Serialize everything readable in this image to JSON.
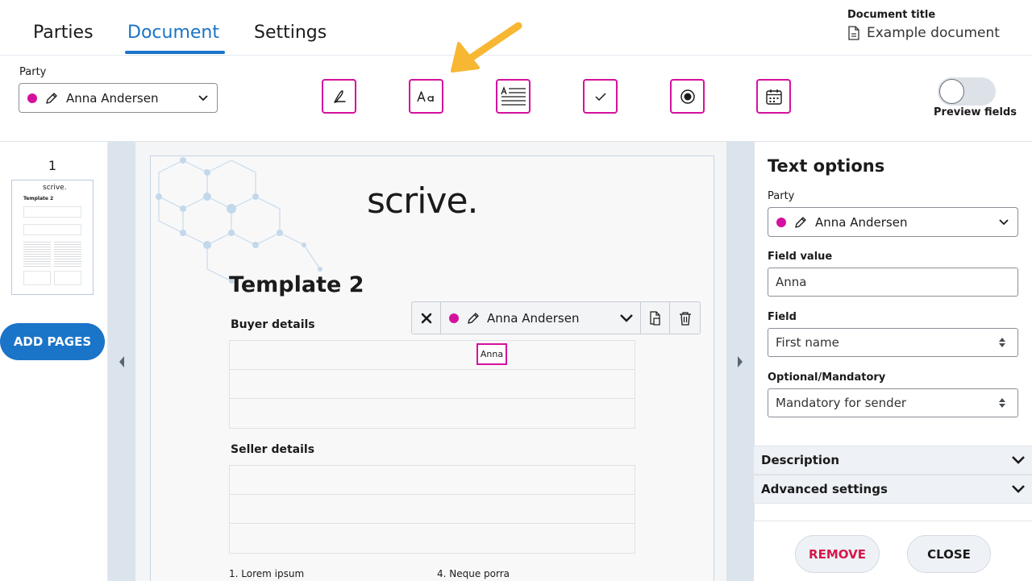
{
  "header": {
    "tabs": [
      {
        "label": "Parties"
      },
      {
        "label": "Document"
      },
      {
        "label": "Settings"
      }
    ],
    "document_title_label": "Document title",
    "document_title_value": "Example document"
  },
  "toolbar": {
    "party_label": "Party",
    "party_value": "Anna Andersen",
    "party_color": "#d4119e",
    "field_tools": [
      {
        "icon": "signature-icon"
      },
      {
        "icon": "text-field-icon"
      },
      {
        "icon": "textarea-icon"
      },
      {
        "icon": "checkbox-icon"
      },
      {
        "icon": "radio-icon"
      },
      {
        "icon": "date-icon"
      }
    ],
    "preview_label": "Preview fields"
  },
  "left_panel": {
    "page_number": "1",
    "thumb_title": "scrive.",
    "thumb_heading": "Template 2",
    "add_pages_label": "ADD PAGES"
  },
  "document": {
    "logo_text": "scrive.",
    "heading": "Template 2",
    "buyer_heading": "Buyer details",
    "seller_heading": "Seller details",
    "list_item_1": "1. Lorem ipsum",
    "list_item_4": "4. Neque porra",
    "field_popup_party": "Anna Andersen",
    "placed_field_value": "Anna"
  },
  "right_panel": {
    "title": "Text options",
    "party_label": "Party",
    "party_value": "Anna Andersen",
    "field_value_label": "Field value",
    "field_value": "Anna",
    "field_label": "Field",
    "field_select": "First name",
    "optional_label": "Optional/Mandatory",
    "optional_select": "Mandatory for sender",
    "description_label": "Description",
    "advanced_label": "Advanced settings",
    "remove_label": "REMOVE",
    "close_label": "CLOSE"
  },
  "colors": {
    "accent_blue": "#1a74c8",
    "party_magenta": "#d4119e",
    "remove_red": "#d6184b",
    "arrow_yellow": "#f7b733"
  }
}
